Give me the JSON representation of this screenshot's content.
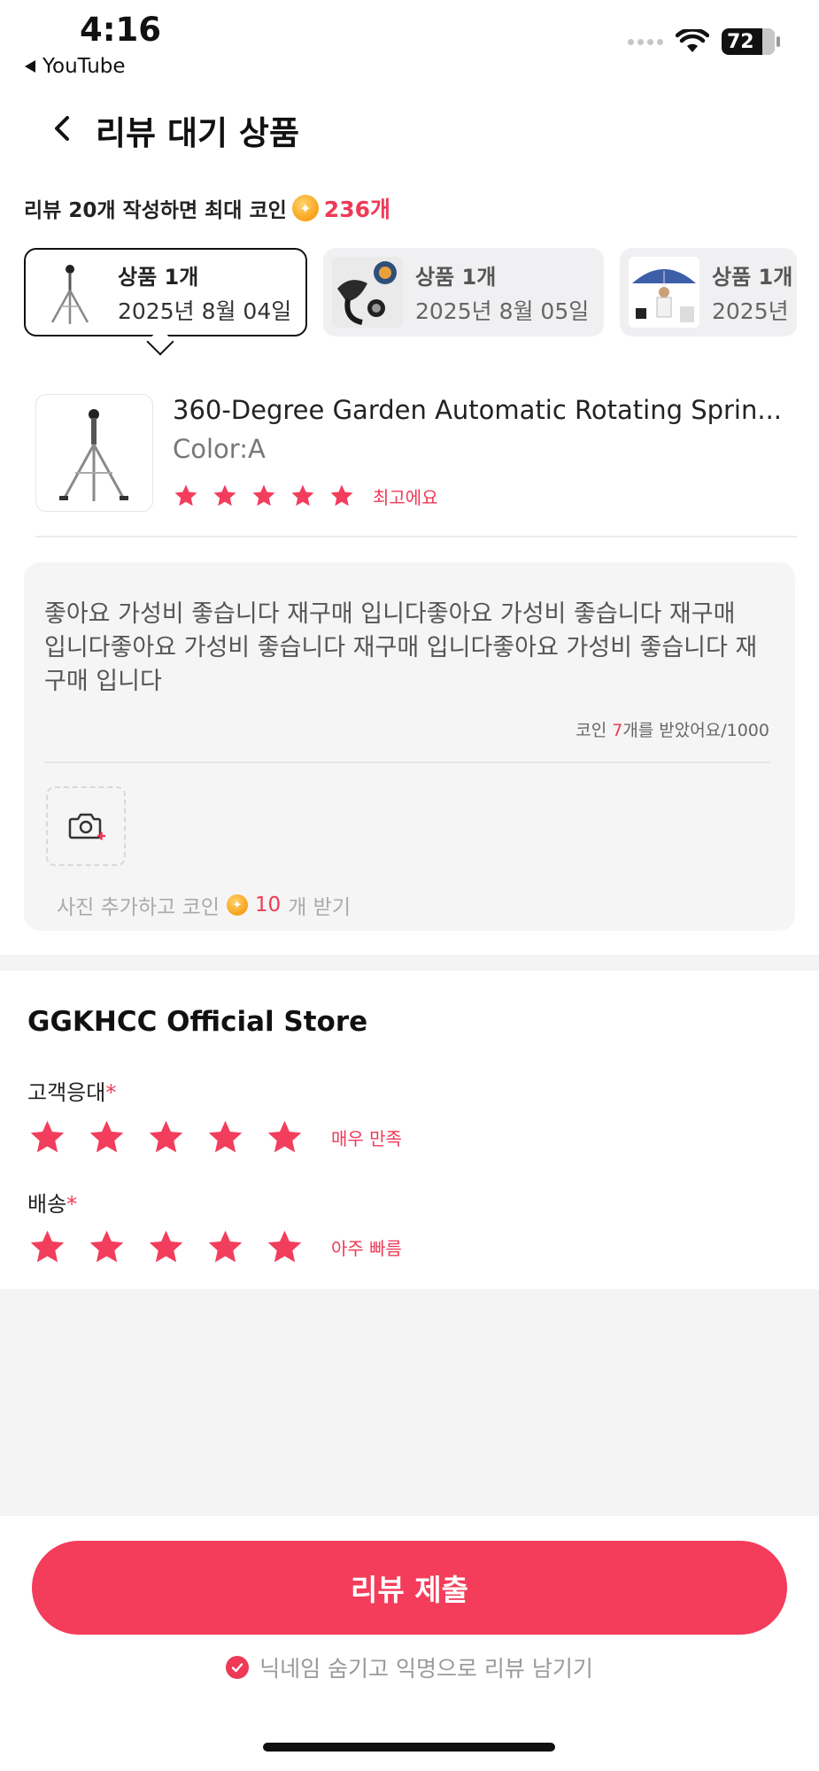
{
  "status_bar": {
    "time": "4:16",
    "back_app": "YouTube",
    "battery": "72"
  },
  "header": {
    "title": "리뷰 대기 상품"
  },
  "promo": {
    "text": "리뷰 20개 작성하면 최대 코인",
    "amount": "236개"
  },
  "product_tabs": [
    {
      "count": "상품 1개",
      "date": "2025년 8월 04일",
      "active": true
    },
    {
      "count": "상품 1개",
      "date": "2025년 8월 05일",
      "active": false
    },
    {
      "count": "상품 1개",
      "date": "2025년",
      "active": false
    }
  ],
  "product": {
    "name": "360-Degree Garden Automatic Rotating Sprin...",
    "variant": "Color:A",
    "rating": 5,
    "rating_label": "최고에요"
  },
  "review": {
    "text": "좋아요 가성비 좋습니다 재구매 입니다좋아요 가성비 좋습니다 재구매 입니다좋아요 가성비 좋습니다 재구매 입니다좋아요 가성비 좋습니다 재구매 입니다",
    "coin_prefix": "코인 ",
    "coin_count": "7",
    "coin_suffix": "개를 받았어요/1000"
  },
  "photo": {
    "hint_prefix": "사진 추가하고 코인",
    "hint_amount": "10",
    "hint_suffix": "개 받기"
  },
  "store": {
    "name": "GGKHCC Official Store",
    "service_label": "고객응대",
    "service_rating": 5,
    "service_rating_label": "매우 만족",
    "delivery_label": "배송",
    "delivery_rating": 5,
    "delivery_rating_label": "아주 빠름",
    "required_mark": "*"
  },
  "footer": {
    "submit_label": "리뷰 제출",
    "anonymous_label": "닉네임 숨기고 익명으로 리뷰 남기기",
    "anonymous_checked": true
  },
  "colors": {
    "accent": "#ee3a57",
    "button": "#f43c5b",
    "coin": "#f7a21b"
  }
}
